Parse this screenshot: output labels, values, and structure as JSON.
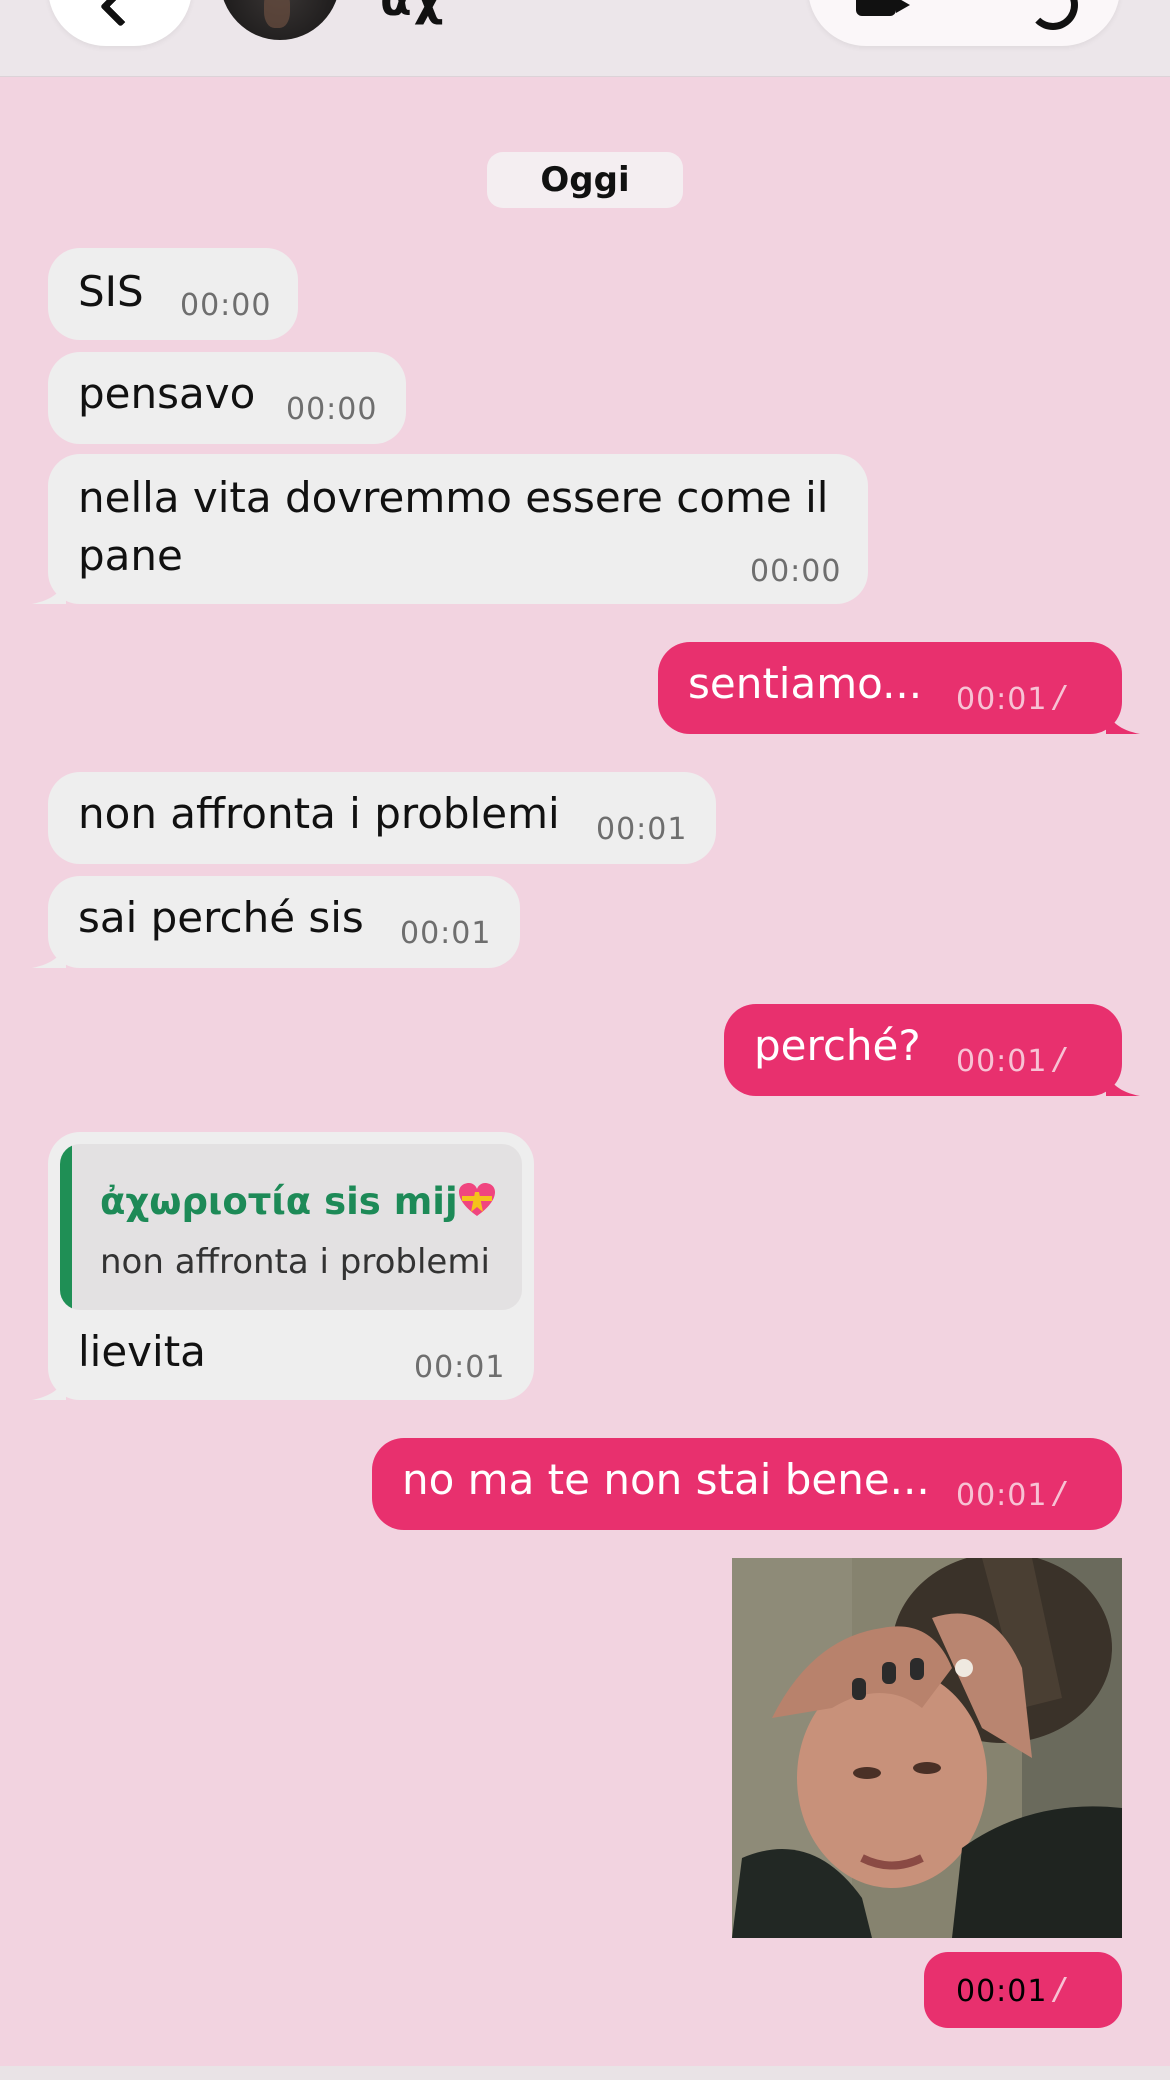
{
  "header": {
    "contact_name": "ἀχ"
  },
  "date_chip": "Oggi",
  "messages": [
    {
      "text": "SIS",
      "time": "00:00"
    },
    {
      "text": "pensavo",
      "time": "00:00"
    },
    {
      "text_line1": "nella vita dovremmo essere come il",
      "text_line2": "pane",
      "time": "00:00"
    },
    {
      "text": "sentiamo...",
      "time": "00:01"
    },
    {
      "text": "non affronta i problemi",
      "time": "00:01"
    },
    {
      "text": "sai perché sis",
      "time": "00:01"
    },
    {
      "text": "perché?",
      "time": "00:01"
    },
    {
      "reply_name": "ἀχωριοτία sis mij",
      "reply_text": "non affronta i problemi",
      "text": "lievita",
      "time": "00:01"
    },
    {
      "text": "no ma te non stai bene...",
      "time": "00:01"
    },
    {
      "time": "00:01"
    }
  ],
  "ticks": "//",
  "colors": {
    "background": "#f2d3e0",
    "outgoing_bubble": "#e8306e",
    "incoming_bubble": "#eeeeee",
    "reply_accent": "#1f8f55"
  },
  "icons": [
    "back-chevron-icon",
    "video-call-icon",
    "phone-call-icon",
    "double-check-icon",
    "heart-ribbon-emoji"
  ]
}
